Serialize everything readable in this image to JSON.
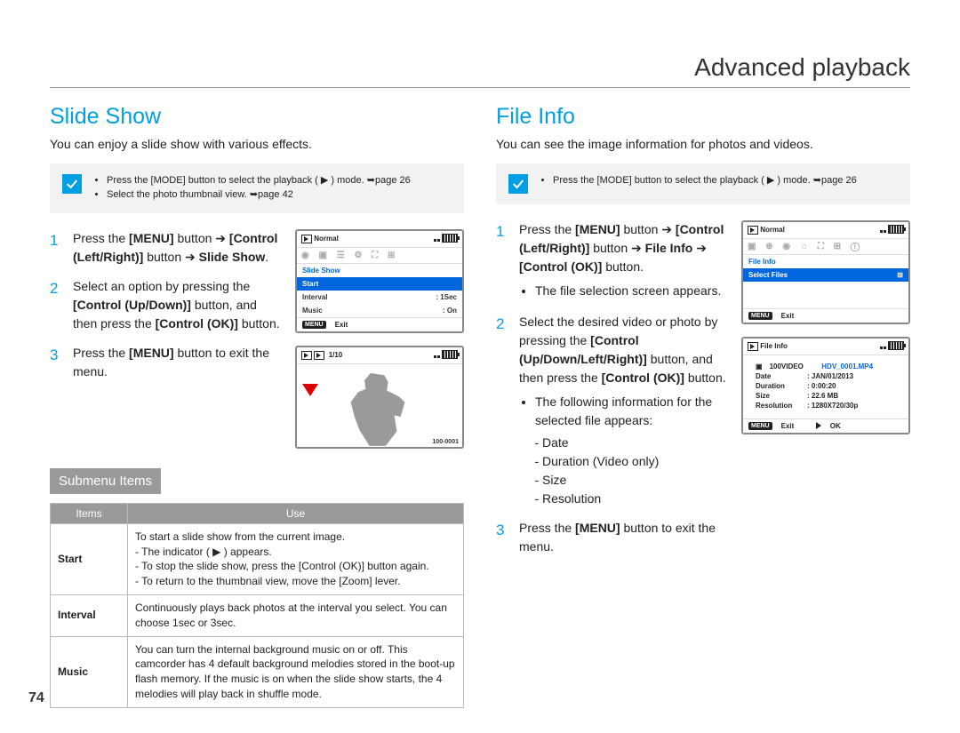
{
  "page_title": "Advanced playback",
  "page_number": "74",
  "left": {
    "heading": "Slide Show",
    "intro": "You can enjoy a slide show with various effects.",
    "note1": "Press the [MODE] button to select the playback ( ▶ ) mode. ➥page 26",
    "note2": "Select the photo thumbnail view. ➥page 42",
    "steps": {
      "s1_a": "Press the ",
      "s1_menu": "[MENU]",
      "s1_b": " button ➔ ",
      "s1_c": "[Control (Left/Right)]",
      "s1_d": " button ➔ ",
      "s1_e": "Slide Show",
      "s2_a": "Select an option by pressing the ",
      "s2_b": "[Control (Up/Down)]",
      "s2_c": " button, and then press the ",
      "s2_d": "[Control (OK)]",
      "s2_e": " button.",
      "s3_a": "Press the ",
      "s3_b": "[MENU]",
      "s3_c": " button to exit the menu."
    },
    "lcd1": {
      "top": "Normal",
      "blue": "Slide Show",
      "sel": "Start",
      "row2k": "Interval",
      "row2v": ": 1Sec",
      "row3k": "Music",
      "row3v": ": On",
      "exit": "Exit"
    },
    "lcd2": {
      "counter": "1/10",
      "file": "100-0001"
    },
    "sub_head": "Submenu Items",
    "table": {
      "h1": "Items",
      "h2": "Use",
      "r1k": "Start",
      "r1v_a": "To start a slide show from the current image.",
      "r1v_b": "The indicator ( ▶ ) appears.",
      "r1v_c": "To stop the slide show, press the [Control (OK)] button again.",
      "r1v_d": "To return to the thumbnail view, move the [Zoom] lever.",
      "r2k": "Interval",
      "r2v": "Continuously plays back photos at the interval you select. You can choose 1sec or 3sec.",
      "r3k": "Music",
      "r3v": "You can turn the internal background music on or off. This camcorder has 4 default background melodies stored in the boot-up flash memory. If the music is on when the slide show starts, the 4 melodies will play back in shuffle mode."
    }
  },
  "right": {
    "heading": "File Info",
    "intro": "You can see the image information for photos and videos.",
    "note1": "Press the [MODE] button to select the playback ( ▶ ) mode. ➥page 26",
    "steps": {
      "s1_a": "Press the ",
      "s1_b": "[MENU]",
      "s1_c": " button ➔ ",
      "s1_d": "[Control (Left/Right)]",
      "s1_e": " button ➔ ",
      "s1_f": "File Info",
      "s1_g": " ➔ ",
      "s1_h": "[Control (OK)]",
      "s1_i": " button.",
      "s1_bullet": "The file selection screen appears.",
      "s2_a": "Select the desired video or photo by pressing the ",
      "s2_b": "[Control (Up/Down/Left/Right)]",
      "s2_c": " button, and then press the ",
      "s2_d": "[Control (OK)]",
      "s2_e": " button.",
      "s2_bullet": "The following information for the selected file appears:",
      "s2_d1": "Date",
      "s2_d2": "Duration (Video only)",
      "s2_d3": "Size",
      "s2_d4": "Resolution",
      "s3_a": "Press the ",
      "s3_b": "[MENU]",
      "s3_c": " button to exit the menu."
    },
    "lcd1": {
      "top": "Normal",
      "blue": "File Info",
      "sel": "Select Files",
      "exit": "Exit"
    },
    "lcd2": {
      "title": "File Info",
      "folder": "100VIDEO",
      "fname": "HDV_0001.MP4",
      "date_k": "Date",
      "date_v": ": JAN/01/2013",
      "dur_k": "Duration",
      "dur_v": ": 0:00:20",
      "size_k": "Size",
      "size_v": ": 22.6 MB",
      "res_k": "Resolution",
      "res_v": ": 1280X720/30p",
      "exit": "Exit",
      "ok": "OK"
    }
  }
}
